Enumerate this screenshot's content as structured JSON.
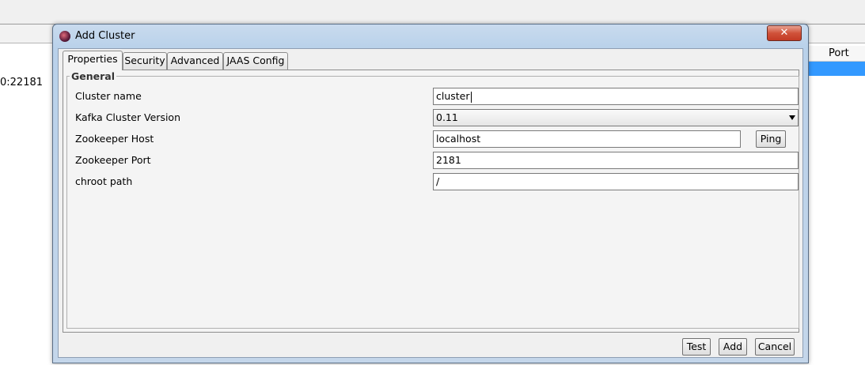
{
  "background": {
    "column_header": "Port",
    "left_cell": "0:22181"
  },
  "dialog": {
    "title": "Add Cluster",
    "close_glyph": "✕",
    "tabs": [
      {
        "label": "Properties"
      },
      {
        "label": "Security"
      },
      {
        "label": "Advanced"
      },
      {
        "label": "JAAS Config"
      }
    ],
    "active_tab": "Properties",
    "group_title": "General",
    "fields": {
      "cluster_name": {
        "label": "Cluster name",
        "value": "cluster"
      },
      "kafka_version": {
        "label": "Kafka Cluster Version",
        "value": "0.11"
      },
      "zookeeper_host": {
        "label": "Zookeeper Host",
        "value": "localhost"
      },
      "zookeeper_port": {
        "label": "Zookeeper Port",
        "value": "2181"
      },
      "chroot_path": {
        "label": "chroot path",
        "value": "/"
      }
    },
    "ping_label": "Ping",
    "buttons": {
      "test": "Test",
      "add": "Add",
      "cancel": "Cancel"
    }
  },
  "colors": {
    "selection": "#3399ff",
    "close_button": "#c33a24",
    "title_bar": "#b9d1ea"
  },
  "icons": {
    "app": "app-icon",
    "close": "close-icon",
    "dropdown": "chevron-down-icon"
  }
}
